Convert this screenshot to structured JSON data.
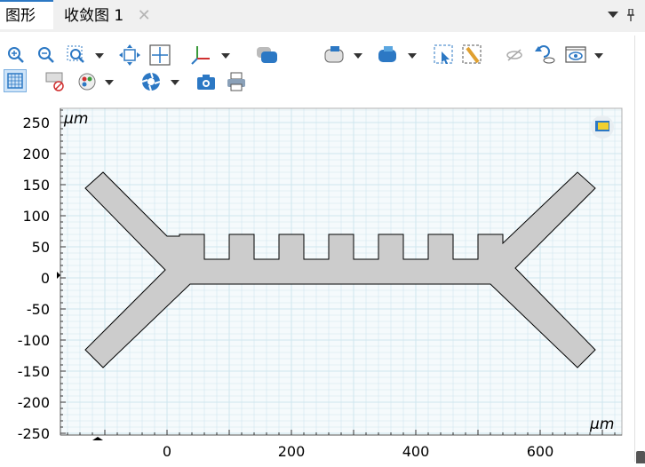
{
  "tabs": {
    "graphics": "图形",
    "convergence": "收敛图 1",
    "close_glyph": "✕"
  },
  "toolbar": {
    "icons": [
      "zoom-in-icon",
      "zoom-out-icon",
      "zoom-box-icon",
      "zoom-extents-icon",
      "zoom-fit-icon",
      "axes-orientation-icon",
      "select-domain-icon",
      "select-boundary-icon",
      "select-point-icon",
      "select-box-icon",
      "clear-selection-icon",
      "hide-icon",
      "reset-hiding-icon",
      "view-icon",
      "grid-icon",
      "scene-light-icon",
      "transparency-icon",
      "render-icon",
      "camera-icon",
      "print-icon"
    ]
  },
  "plot": {
    "unit_top": "μm",
    "unit_bottom": "μm",
    "y_ticks": [
      "250",
      "200",
      "150",
      "100",
      "50",
      "0",
      "-50",
      "-100",
      "-150",
      "-200",
      "-250"
    ],
    "x_ticks": [
      "0",
      "200",
      "400",
      "600"
    ],
    "colors": {
      "grid": "#cfe6ee",
      "fill": "#cccccc",
      "stroke": "#000000",
      "frame": "#f2f7fa"
    }
  }
}
